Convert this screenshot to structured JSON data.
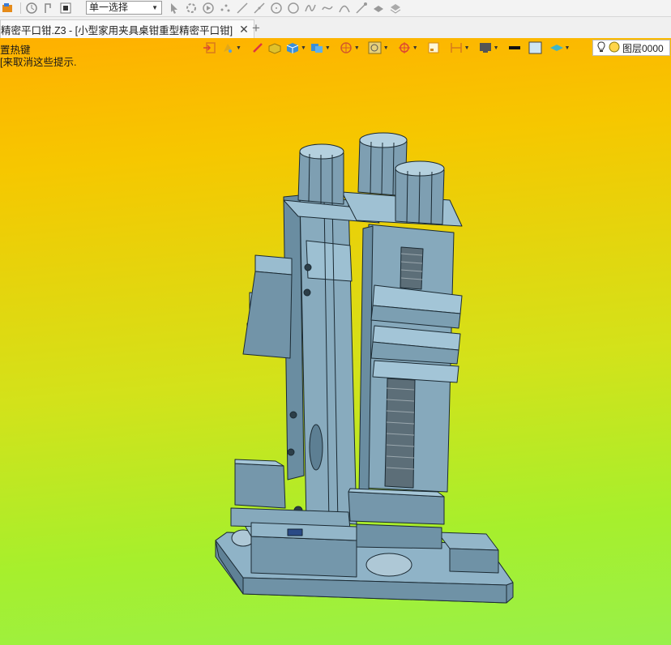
{
  "toolbar": {
    "selection_mode": "单一选择",
    "icons": [
      "app-logo-icon",
      "history-icon",
      "pick-icon",
      "stop-icon",
      "cursor-icon",
      "filter-icon",
      "play-icon",
      "point-icon",
      "line-icon",
      "line2-icon",
      "circle-icon",
      "circle2-icon",
      "curve-icon",
      "spline-icon",
      "arc-icon",
      "sketch-icon",
      "layer-icon",
      "stack-icon"
    ]
  },
  "tab": {
    "title": "精密平口钳.Z3 - [小型家用夹具桌钳重型精密平口钳]",
    "close": "✕",
    "add": "+"
  },
  "hints": {
    "line1": "置热键",
    "line2": "[来取消这些提示."
  },
  "view_toolbar": {
    "layer_label": "图层0000",
    "colors": {
      "accent_black": "#111111",
      "accent_box": "#cfe6f3"
    }
  },
  "viewport": {
    "gradient_top": "#ffb000",
    "gradient_bottom": "#98f04a",
    "model_color": "#7fa2b6"
  }
}
